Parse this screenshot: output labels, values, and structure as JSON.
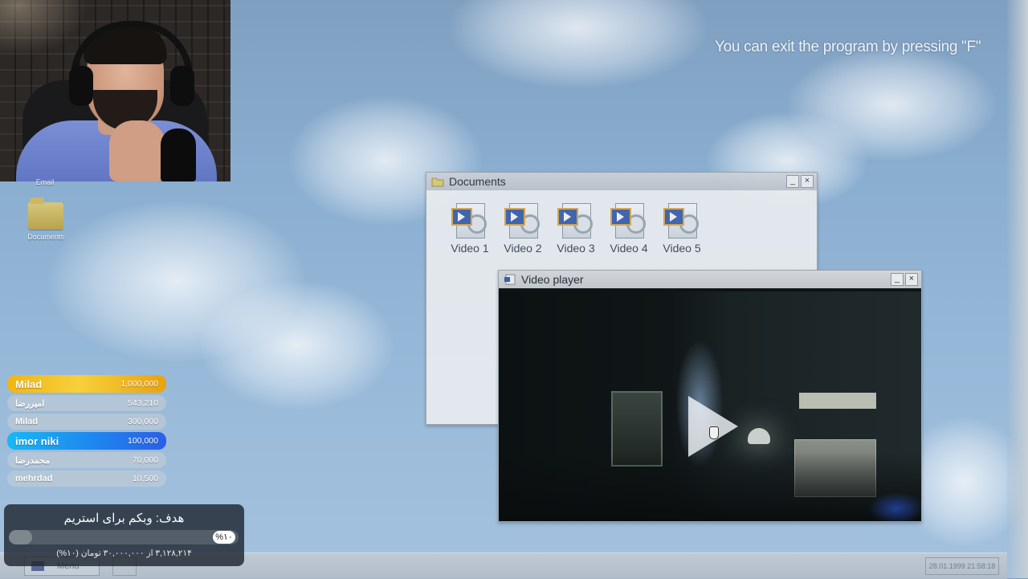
{
  "hint_text": "You can exit the program by pressing \"F\"",
  "desktop": {
    "icons": [
      {
        "label": "Email",
        "icon": "email-icon"
      },
      {
        "label": "Documents",
        "icon": "folder-icon"
      }
    ]
  },
  "documents_window": {
    "title": "Documents",
    "files": [
      "Video 1",
      "Video 2",
      "Video 3",
      "Video 4",
      "Video 5"
    ]
  },
  "video_player": {
    "title": "Video player",
    "state": "paused"
  },
  "leaderboard": [
    {
      "name": "Milad",
      "amount": "1,000,000",
      "style": "gold"
    },
    {
      "name": "امیررضا",
      "amount": "543,210",
      "style": "plain"
    },
    {
      "name": "Milad",
      "amount": "300,000",
      "style": "plain"
    },
    {
      "name": "imor niki",
      "amount": "100,000",
      "style": "blue"
    },
    {
      "name": "محمدرضا",
      "amount": "70,000",
      "style": "plain"
    },
    {
      "name": "mehrdad",
      "amount": "10,500",
      "style": "plain"
    }
  ],
  "goal": {
    "title": "هدف: وبکم برای استریم",
    "percent_label": "%۱۰",
    "progress_fraction": 0.1,
    "subtitle": "۳,۱۲۸,۲۱۴ از ۳۰,۰۰۰,۰۰۰ تومان (۱۰%)"
  },
  "taskbar": {
    "start_label": "Menu",
    "clock": "28.01.1999 21:58:18"
  },
  "colors": {
    "gold": "#f0b512",
    "blue": "#1f86ef",
    "sky": "#8aaed0"
  }
}
